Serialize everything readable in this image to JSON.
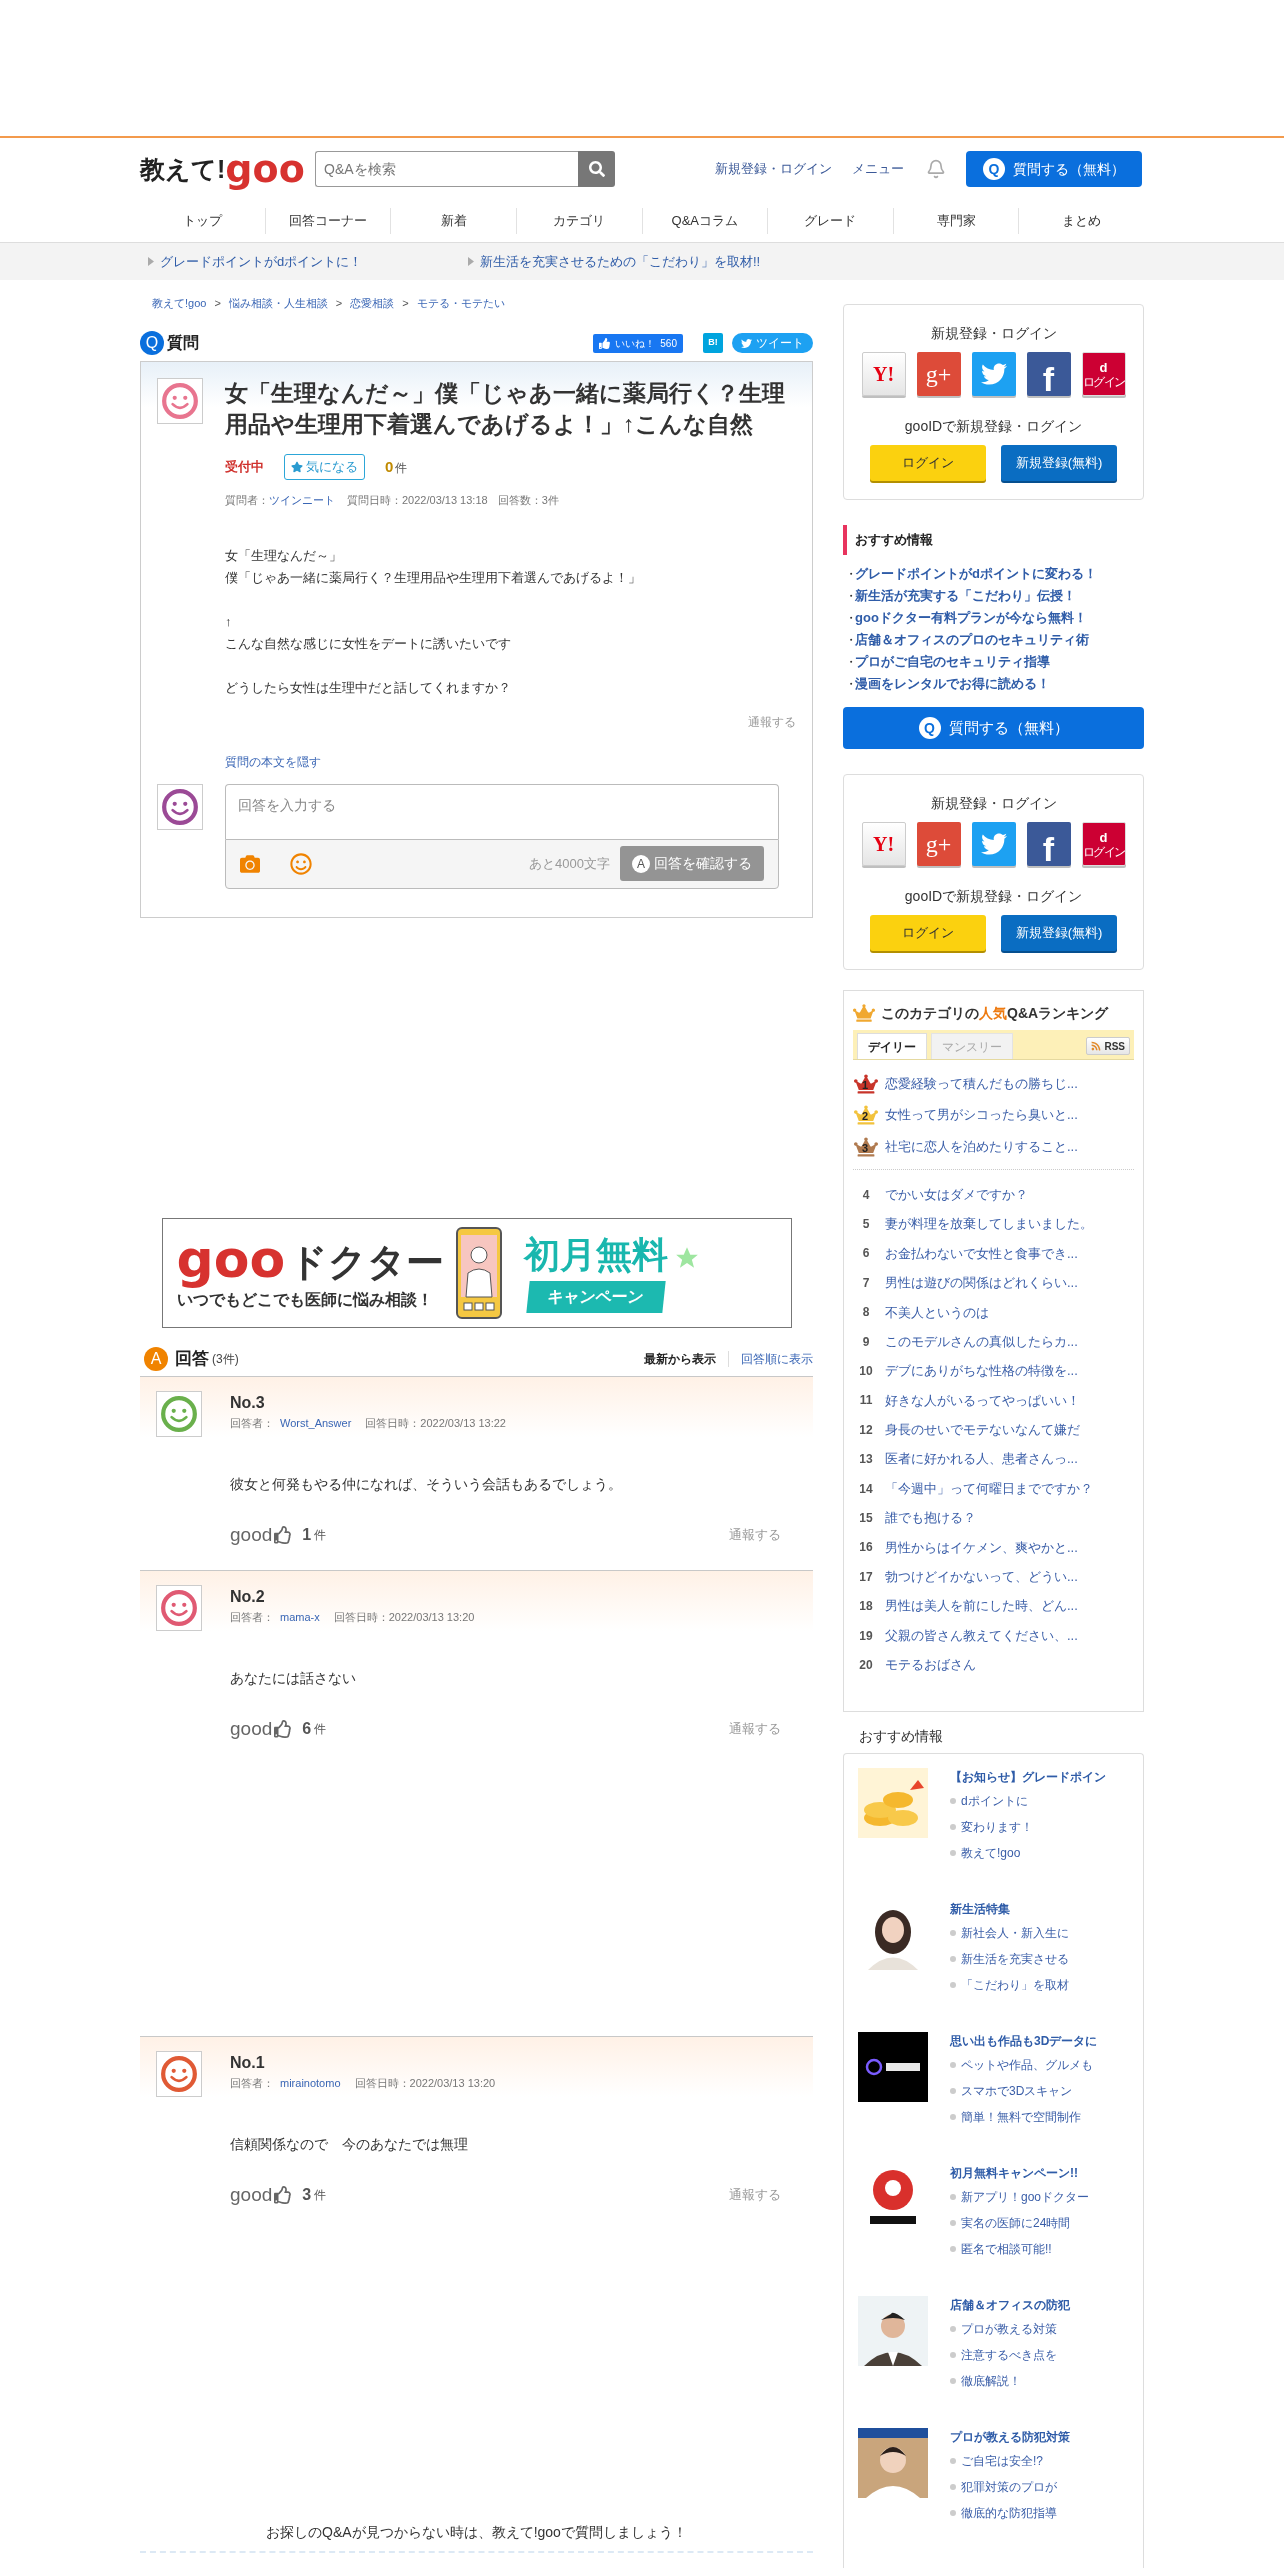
{
  "logo": {
    "prefix": "教えて!",
    "brand": "goo"
  },
  "search": {
    "placeholder": "Q&Aを検索"
  },
  "header_links": [
    "新規登録・ログイン",
    "メニュー"
  ],
  "ask_button": {
    "icon": "Q",
    "label": "質問する（無料）"
  },
  "nav": [
    "トップ",
    "回答コーナー",
    "新着",
    "カテゴリ",
    "Q&Aコラム",
    "グレード",
    "専門家",
    "まとめ"
  ],
  "promos": [
    "グレードポイントがdポイントに！",
    "新生活を充実させるための「こだわり」を取材!!"
  ],
  "breadcrumb": {
    "items": [
      "教えて!goo",
      "悩み相談・人生相談",
      "恋愛相談",
      "モテる・モテたい"
    ],
    "separator": ">"
  },
  "question": {
    "badge": "Q",
    "heading": "質問",
    "like": {
      "label": "いいね！",
      "count": "560"
    },
    "hatena": "B!",
    "tweet": "ツイート",
    "title": "女「生理なんだ～」僕「じゃあ一緒に薬局行く？生理用品や生理用下着選んであげるよ！」↑こんな自然",
    "status": "受付中",
    "watch_button": "気になる",
    "watch_count": "0",
    "watch_unit": "件",
    "asker_label": "質問者：",
    "asker": "ツインニート",
    "date": "質問日時：2022/03/13 13:18",
    "answer_count": "回答数：3件",
    "body": [
      [
        "女「生理なんだ～」",
        "僕「じゃあ一緒に薬局行く？生理用品や生理用下着選んであげるよ！」"
      ],
      [
        "↑",
        "こんな自然な感じに女性をデートに誘いたいです"
      ],
      [
        "どうしたら女性は生理中だと話してくれますか？"
      ]
    ],
    "report": "通報する",
    "hide_link": "質問の本文を隠す"
  },
  "answer_form": {
    "placeholder": "回答を入力する",
    "remaining": "あと4000文字",
    "submit": {
      "icon": "A",
      "label": "回答を確認する",
      "disabled": true
    }
  },
  "banner": {
    "brand": "goo",
    "service": "ドクター",
    "tagline": "いつでもどこでも医師に悩み相談！",
    "offer": "初月無料",
    "ribbon": "キャンペーン"
  },
  "answers": {
    "badge": "A",
    "heading": "回答",
    "count": "(3件)",
    "sort": [
      {
        "label": "最新から表示",
        "selected": true
      },
      {
        "label": "回答順に表示",
        "selected": false
      }
    ],
    "items": [
      {
        "number": "No.3",
        "answerer_label": "回答者：",
        "answerer": "Worst_Answer",
        "date": "回答日時：2022/03/13 13:22",
        "color": "#6ab04c",
        "text": "彼女と何発もやる仲になれば、そういう会話もあるでしょう。",
        "good_label": "good",
        "good_count": "1",
        "good_unit": "件",
        "report": "通報する"
      },
      {
        "number": "No.2",
        "answerer_label": "回答者：",
        "answerer": "mama-x",
        "date": "回答日時：2022/03/13 13:20",
        "color": "#e05a73",
        "text": "あなたには話さない",
        "good_label": "good",
        "good_count": "6",
        "good_unit": "件",
        "report": "通報する"
      },
      {
        "number": "No.1",
        "answerer_label": "回答者：",
        "answerer": "mirainotomo",
        "date": "回答日時：2022/03/13 13:20",
        "color": "#e05a35",
        "text": "信頼関係なので　今のあなたでは無理",
        "good_label": "good",
        "good_count": "3",
        "good_unit": "件",
        "report": "通報する"
      }
    ]
  },
  "footer_prompt": "お探しのQ&Aが見つからない時は、教えて!gooで質問しましょう！",
  "sidebar": {
    "login_top": {
      "title": "新規登録・ログイン",
      "social": [
        {
          "kind": "yahoo",
          "label": "Y!"
        },
        {
          "kind": "google",
          "label": "g+"
        },
        {
          "kind": "twitter"
        },
        {
          "kind": "facebook",
          "label": "f"
        },
        {
          "kind": "docomo",
          "label": "d",
          "sublabel": "ログイン"
        }
      ],
      "subtitle": "gooIDで新規登録・ログイン",
      "login": "ログイン",
      "register": "新規登録(無料)"
    },
    "recommended": {
      "title": "おすすめ情報",
      "bullet": "・",
      "links": [
        "グレードポイントがdポイントに変わる！",
        "新生活が充実する「こだわり」伝授！",
        "gooドクター有料プランが今なら無料！",
        "店舗＆オフィスのプロのセキュリティ術",
        "プロがご自宅のセキュリティ指導",
        "漫画をレンタルでお得に読める！"
      ]
    },
    "ask_button": {
      "icon": "Q",
      "label": "質問する（無料）"
    },
    "login_bottom": {
      "title": "新規登録・ログイン",
      "social": [
        {
          "kind": "yahoo",
          "label": "Y!"
        },
        {
          "kind": "google",
          "label": "g+"
        },
        {
          "kind": "twitter"
        },
        {
          "kind": "facebook",
          "label": "f"
        },
        {
          "kind": "docomo",
          "label": "d",
          "sublabel": "ログイン"
        }
      ],
      "subtitle": "gooIDで新規登録・ログイン",
      "login": "ログイン",
      "register": "新規登録(無料)"
    },
    "ranking": {
      "title_before": "このカテゴリの",
      "title_highlight": "人気",
      "title_after": "Q&Aランキング",
      "tabs": [
        {
          "label": "デイリー",
          "selected": true
        },
        {
          "label": "マンスリー",
          "selected": false
        }
      ],
      "rss": "RSS",
      "items": [
        {
          "kind": "crown",
          "rank": "1",
          "color": "#c8342a",
          "title": "恋愛経験って積んだもの勝ちじ..."
        },
        {
          "kind": "crown",
          "rank": "2",
          "color": "#f2c23c",
          "title": "女性って男がシコったら臭いと..."
        },
        {
          "kind": "crown",
          "rank": "3",
          "color": "#b07a4f",
          "title": "社宅に恋人を泊めたりすること..."
        },
        {
          "kind": "plain",
          "rank": "4",
          "title": "でかい女はダメですか？"
        },
        {
          "kind": "plain",
          "rank": "5",
          "title": "妻が料理を放棄してしまいました。"
        },
        {
          "kind": "plain",
          "rank": "6",
          "title": "お金払わないで女性と食事でき..."
        },
        {
          "kind": "plain",
          "rank": "7",
          "title": "男性は遊びの関係はどれくらい..."
        },
        {
          "kind": "plain",
          "rank": "8",
          "title": "不美人というのは"
        },
        {
          "kind": "plain",
          "rank": "9",
          "title": "このモデルさんの真似したらカ..."
        },
        {
          "kind": "plain",
          "rank": "10",
          "title": "デブにありがちな性格の特徴を..."
        },
        {
          "kind": "plain",
          "rank": "11",
          "title": "好きな人がいるってやっぱいい！"
        },
        {
          "kind": "plain",
          "rank": "12",
          "title": "身長のせいでモテないなんて嫌だ"
        },
        {
          "kind": "plain",
          "rank": "13",
          "title": "医者に好かれる人、患者さんっ..."
        },
        {
          "kind": "plain",
          "rank": "14",
          "title": "「今週中」って何曜日までですか？"
        },
        {
          "kind": "plain",
          "rank": "15",
          "title": "誰でも抱ける？"
        },
        {
          "kind": "plain",
          "rank": "16",
          "title": "男性からはイケメン、爽やかと..."
        },
        {
          "kind": "plain",
          "rank": "17",
          "title": "勃つけどイかないって、どうい..."
        },
        {
          "kind": "plain",
          "rank": "18",
          "title": "男性は美人を前にした時、どん..."
        },
        {
          "kind": "plain",
          "rank": "19",
          "title": "父親の皆さん教えてください、..."
        },
        {
          "kind": "plain",
          "rank": "20",
          "title": "モテるおばさん"
        }
      ]
    },
    "info": {
      "title": "おすすめ情報",
      "items": [
        {
          "heading": "【お知らせ】グレードポイン",
          "lines": [
            "dポイントに",
            "変わります！",
            "教えて!goo"
          ]
        },
        {
          "heading": "新生活特集",
          "lines": [
            "新社会人・新入生に",
            "新生活を充実させる",
            "「こだわり」を取材"
          ]
        },
        {
          "heading": "思い出も作品も3Dデータに",
          "lines": [
            "ペットや作品、グルメも",
            "スマホで3Dスキャン",
            "簡単！無料で空間制作"
          ]
        },
        {
          "heading": "初月無料キャンペーン!!",
          "lines": [
            "新アプリ！gooドクター",
            "実名の医師に24時間",
            "匿名で相談可能!!"
          ]
        },
        {
          "heading": "店舗＆オフィスの防犯",
          "lines": [
            "プロが教える対策",
            "注意するべき点を",
            "徹底解説！"
          ]
        },
        {
          "heading": "プロが教える防犯対策",
          "lines": [
            "ご自宅は安全!?",
            "犯罪対策のプロが",
            "徹底的な防犯指導"
          ]
        }
      ]
    }
  }
}
